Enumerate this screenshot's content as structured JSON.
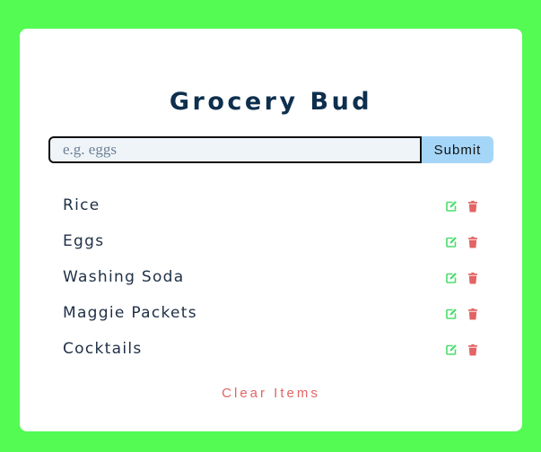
{
  "app": {
    "title": "Grocery Bud",
    "form": {
      "input_value": "",
      "placeholder": "e.g. eggs",
      "submit_label": "Submit"
    },
    "items": [
      {
        "name": "Rice"
      },
      {
        "name": "Eggs"
      },
      {
        "name": "Washing Soda"
      },
      {
        "name": "Maggie Packets"
      },
      {
        "name": "Cocktails"
      }
    ],
    "clear_label": "Clear Items",
    "icons": {
      "edit": "edit-icon",
      "delete": "trash-icon"
    },
    "colors": {
      "background": "#53fb53",
      "title": "#0e2f4d",
      "submit": "#a6d6f7",
      "edit": "#4ade6a",
      "delete": "#e26464"
    }
  }
}
